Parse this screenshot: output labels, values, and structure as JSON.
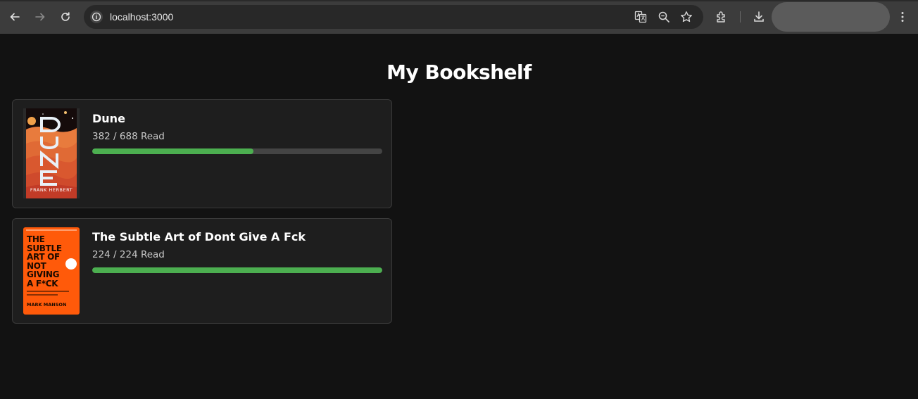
{
  "browser": {
    "url": "localhost:3000"
  },
  "page": {
    "title": "My Bookshelf"
  },
  "books": [
    {
      "title": "Dune",
      "pages_read": 382,
      "total_pages": 688,
      "progress_label": "382 / 688 Read",
      "cover": {
        "title_text": "DUNE",
        "author_text": "FRANK HERBERT"
      }
    },
    {
      "title": "The Subtle Art of Dont Give A Fck",
      "pages_read": 224,
      "total_pages": 224,
      "progress_label": "224 / 224 Read",
      "cover": {
        "title_lines": [
          "THE",
          "SUBTLE",
          "ART OF",
          "NOT",
          "GIVING",
          "A F*CK"
        ],
        "author_text": "MARK MANSON"
      }
    }
  ],
  "colors": {
    "page_bg": "#121212",
    "card_bg": "#1e1e1e",
    "progress_fill": "#4caf50",
    "progress_track": "#444444"
  }
}
